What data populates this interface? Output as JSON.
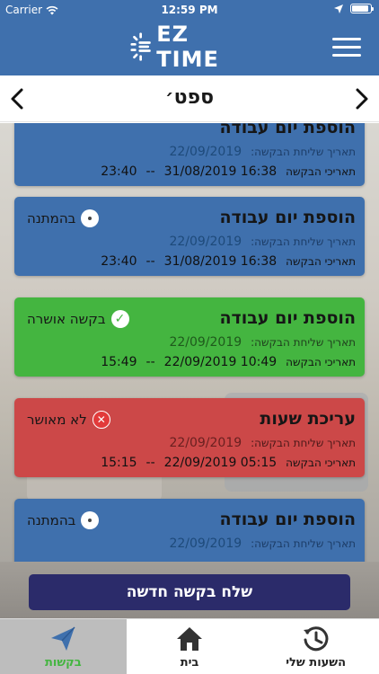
{
  "status_bar": {
    "carrier": "Carrier",
    "time": "12:59 PM"
  },
  "header": {
    "logo_text": "EZ TIME"
  },
  "month_nav": {
    "month": "ספט׳"
  },
  "labels": {
    "sent_date": "תאריך שליחת הבקשה:",
    "request_dates": "תאריכי הבקשה",
    "separator": "--"
  },
  "requests": [
    {
      "type": "הוספת יום עבודה",
      "status": "",
      "status_kind": "pending",
      "color": "blue",
      "sent": "22/09/2019",
      "start": "31/08/2019 16:38",
      "end": "23:40"
    },
    {
      "type": "הוספת יום עבודה",
      "status": "בהמתנה",
      "status_kind": "pending",
      "color": "blue",
      "sent": "22/09/2019",
      "start": "31/08/2019 16:38",
      "end": "23:40"
    },
    {
      "type": "הוספת יום עבודה",
      "status": "בקשה אושרה",
      "status_kind": "approved",
      "color": "green",
      "sent": "22/09/2019",
      "start": "22/09/2019 10:49",
      "end": "15:49"
    },
    {
      "type": "עריכת שעות",
      "status": "לא מאושר",
      "status_kind": "rejected",
      "color": "red",
      "sent": "22/09/2019",
      "start": "22/09/2019 05:15",
      "end": "15:15"
    },
    {
      "type": "הוספת יום עבודה",
      "status": "בהמתנה",
      "status_kind": "pending",
      "color": "blue",
      "sent": "22/09/2019",
      "start": "",
      "end": ""
    }
  ],
  "new_request_button": "שלח בקשה חדשה",
  "tabs": [
    {
      "label": "בקשות",
      "icon": "paper-plane-icon",
      "active": true
    },
    {
      "label": "בית",
      "icon": "home-icon",
      "active": false
    },
    {
      "label": "השעות שלי",
      "icon": "history-icon",
      "active": false
    }
  ],
  "colors": {
    "blue": "#3f70ad",
    "green": "#44b540",
    "red": "#cc4848",
    "button": "#2b2b6a",
    "accent": "#44b540"
  }
}
